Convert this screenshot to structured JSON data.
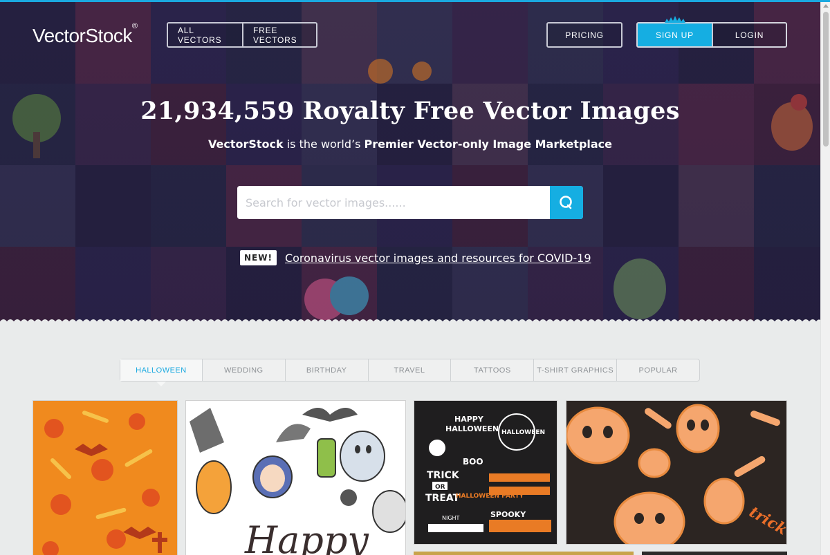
{
  "header": {
    "logo_text": "VectorStock",
    "logo_mark": "®",
    "nav": {
      "all_vectors": "ALL VECTORS",
      "free_vectors": "FREE VECTORS",
      "pricing": "PRICING",
      "sign_up": "SIGN UP",
      "login": "LOGIN"
    }
  },
  "hero": {
    "headline": "21,934,559 Royalty Free Vector Images",
    "subline_brand": "VectorStock",
    "subline_mid": " is the world’s ",
    "subline_strong": "Premier Vector-only Image Marketplace",
    "search": {
      "placeholder": "Search for vector images......",
      "value": "",
      "button_icon": "search-icon"
    },
    "promo": {
      "badge": "NEW!",
      "link": "Coronavirus vector images and resources for COVID-19"
    }
  },
  "tabs": [
    {
      "label": "HALLOWEEN",
      "active": true
    },
    {
      "label": "WEDDING"
    },
    {
      "label": "BIRTHDAY"
    },
    {
      "label": "TRAVEL"
    },
    {
      "label": "TATTOOS"
    },
    {
      "label": "T-SHIRT GRAPHICS"
    },
    {
      "label": "POPULAR"
    }
  ],
  "gallery": {
    "thumb3_top": "HAPPY",
    "thumb3_halloween": "HALLOWEEN",
    "thumb3_trick": "TRICK",
    "thumb3_or": "OR",
    "thumb3_treat": "TREAT",
    "thumb3_boo": "BOO",
    "thumb3_spooky": "SPOOKY",
    "thumb3_party": "HALLOWEEN PARTY",
    "thumb3_night": "NIGHT",
    "thumb2_script": "Happy",
    "thumb4_text": "trick or treat"
  },
  "colors": {
    "accent": "#15aee2",
    "tab_active": "#1aa9e0",
    "page_bg": "#e9ebeb"
  }
}
